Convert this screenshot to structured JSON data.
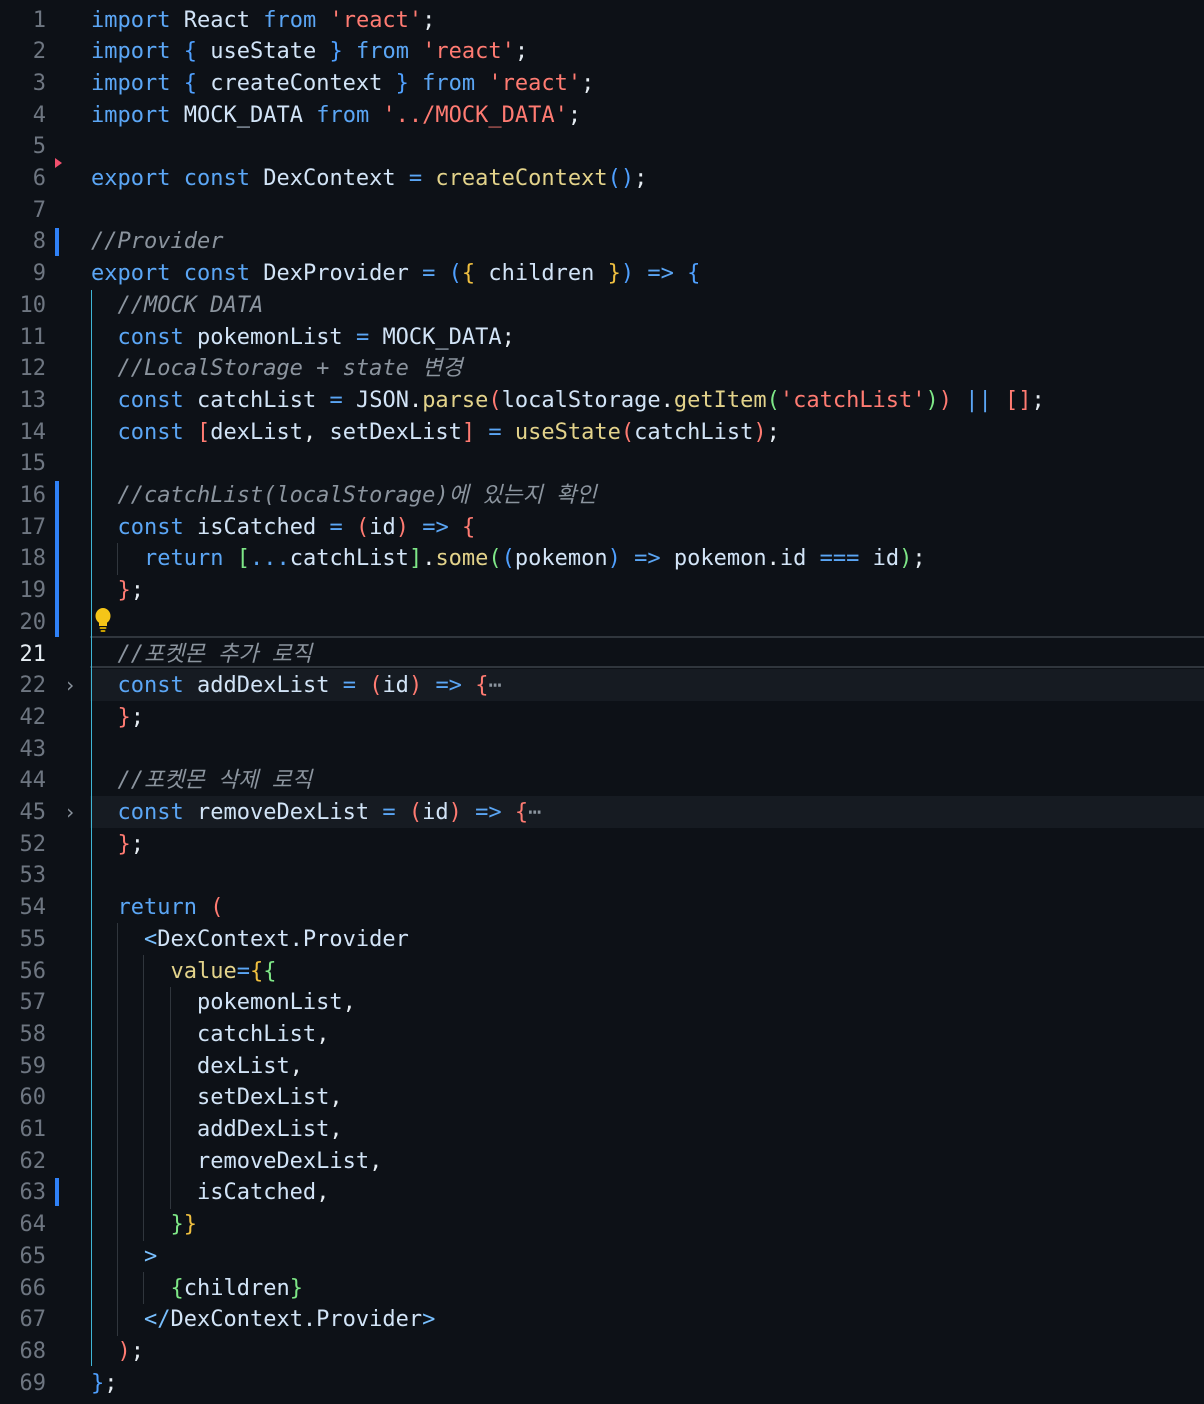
{
  "editor": {
    "active_line": "21",
    "lines": [
      {
        "n": "1",
        "tokens": [
          [
            "k",
            "import"
          ],
          [
            "p",
            " "
          ],
          [
            "v",
            "React"
          ],
          [
            "p",
            " "
          ],
          [
            "k",
            "from"
          ],
          [
            "p",
            " "
          ],
          [
            "s",
            "'react'"
          ],
          [
            "p",
            ";"
          ]
        ]
      },
      {
        "n": "2",
        "tokens": [
          [
            "k",
            "import"
          ],
          [
            "p",
            " "
          ],
          [
            "b3",
            "{"
          ],
          [
            "p",
            " "
          ],
          [
            "v",
            "useState"
          ],
          [
            "p",
            " "
          ],
          [
            "b3",
            "}"
          ],
          [
            "p",
            " "
          ],
          [
            "k",
            "from"
          ],
          [
            "p",
            " "
          ],
          [
            "s",
            "'react'"
          ],
          [
            "p",
            ";"
          ]
        ]
      },
      {
        "n": "3",
        "tokens": [
          [
            "k",
            "import"
          ],
          [
            "p",
            " "
          ],
          [
            "b3",
            "{"
          ],
          [
            "p",
            " "
          ],
          [
            "v",
            "createContext"
          ],
          [
            "p",
            " "
          ],
          [
            "b3",
            "}"
          ],
          [
            "p",
            " "
          ],
          [
            "k",
            "from"
          ],
          [
            "p",
            " "
          ],
          [
            "s",
            "'react'"
          ],
          [
            "p",
            ";"
          ]
        ]
      },
      {
        "n": "4",
        "tokens": [
          [
            "k",
            "import"
          ],
          [
            "p",
            " "
          ],
          [
            "v",
            "MOCK_DATA"
          ],
          [
            "p",
            " "
          ],
          [
            "k",
            "from"
          ],
          [
            "p",
            " "
          ],
          [
            "s",
            "'../MOCK_DATA'"
          ],
          [
            "p",
            ";"
          ]
        ]
      },
      {
        "n": "5",
        "tokens": []
      },
      {
        "n": "6",
        "tokens": [
          [
            "k",
            "export"
          ],
          [
            "p",
            " "
          ],
          [
            "k",
            "const"
          ],
          [
            "p",
            " "
          ],
          [
            "v",
            "DexContext"
          ],
          [
            "p",
            " "
          ],
          [
            "o",
            "="
          ],
          [
            "p",
            " "
          ],
          [
            "f",
            "createContext"
          ],
          [
            "b3",
            "()"
          ],
          [
            "p",
            ";"
          ]
        ]
      },
      {
        "n": "7",
        "tokens": []
      },
      {
        "n": "8",
        "tokens": [
          [
            "c",
            "//Provider"
          ]
        ]
      },
      {
        "n": "9",
        "tokens": [
          [
            "k",
            "export"
          ],
          [
            "p",
            " "
          ],
          [
            "k",
            "const"
          ],
          [
            "p",
            " "
          ],
          [
            "v",
            "DexProvider"
          ],
          [
            "p",
            " "
          ],
          [
            "o",
            "="
          ],
          [
            "p",
            " "
          ],
          [
            "b3",
            "("
          ],
          [
            "b1",
            "{"
          ],
          [
            "p",
            " "
          ],
          [
            "v",
            "children"
          ],
          [
            "p",
            " "
          ],
          [
            "b1",
            "}"
          ],
          [
            "b3",
            ")"
          ],
          [
            "p",
            " "
          ],
          [
            "o",
            "=>"
          ],
          [
            "p",
            " "
          ],
          [
            "b3",
            "{"
          ]
        ]
      },
      {
        "n": "10",
        "tokens": [
          [
            "p",
            "  "
          ],
          [
            "c",
            "//MOCK DATA"
          ]
        ]
      },
      {
        "n": "11",
        "tokens": [
          [
            "p",
            "  "
          ],
          [
            "k",
            "const"
          ],
          [
            "p",
            " "
          ],
          [
            "v",
            "pokemonList"
          ],
          [
            "p",
            " "
          ],
          [
            "o",
            "="
          ],
          [
            "p",
            " "
          ],
          [
            "v",
            "MOCK_DATA"
          ],
          [
            "p",
            ";"
          ]
        ]
      },
      {
        "n": "12",
        "tokens": [
          [
            "p",
            "  "
          ],
          [
            "c",
            "//LocalStorage + state 변경"
          ]
        ]
      },
      {
        "n": "13",
        "tokens": [
          [
            "p",
            "  "
          ],
          [
            "k",
            "const"
          ],
          [
            "p",
            " "
          ],
          [
            "v",
            "catchList"
          ],
          [
            "p",
            " "
          ],
          [
            "o",
            "="
          ],
          [
            "p",
            " "
          ],
          [
            "v",
            "JSON"
          ],
          [
            "p",
            "."
          ],
          [
            "f",
            "parse"
          ],
          [
            "pr",
            "("
          ],
          [
            "v",
            "localStorage"
          ],
          [
            "p",
            "."
          ],
          [
            "f",
            "getItem"
          ],
          [
            "g",
            "("
          ],
          [
            "s",
            "'catchList'"
          ],
          [
            "g",
            ")"
          ],
          [
            "pr",
            ")"
          ],
          [
            "p",
            " "
          ],
          [
            "o",
            "||"
          ],
          [
            "p",
            " "
          ],
          [
            "pr",
            "[]"
          ],
          [
            "p",
            ";"
          ]
        ]
      },
      {
        "n": "14",
        "tokens": [
          [
            "p",
            "  "
          ],
          [
            "k",
            "const"
          ],
          [
            "p",
            " "
          ],
          [
            "pr",
            "["
          ],
          [
            "v",
            "dexList"
          ],
          [
            "p",
            ", "
          ],
          [
            "v",
            "setDexList"
          ],
          [
            "pr",
            "]"
          ],
          [
            "p",
            " "
          ],
          [
            "o",
            "="
          ],
          [
            "p",
            " "
          ],
          [
            "f",
            "useState"
          ],
          [
            "pr",
            "("
          ],
          [
            "v",
            "catchList"
          ],
          [
            "pr",
            ")"
          ],
          [
            "p",
            ";"
          ]
        ]
      },
      {
        "n": "15",
        "tokens": []
      },
      {
        "n": "16",
        "tokens": [
          [
            "p",
            "  "
          ],
          [
            "c",
            "//catchList(localStorage)에 있는지 확인"
          ]
        ]
      },
      {
        "n": "17",
        "tokens": [
          [
            "p",
            "  "
          ],
          [
            "k",
            "const"
          ],
          [
            "p",
            " "
          ],
          [
            "v",
            "isCatched"
          ],
          [
            "p",
            " "
          ],
          [
            "o",
            "="
          ],
          [
            "p",
            " "
          ],
          [
            "pr",
            "("
          ],
          [
            "v",
            "id"
          ],
          [
            "pr",
            ")"
          ],
          [
            "p",
            " "
          ],
          [
            "o",
            "=>"
          ],
          [
            "p",
            " "
          ],
          [
            "pr",
            "{"
          ]
        ]
      },
      {
        "n": "18",
        "tokens": [
          [
            "p",
            "    "
          ],
          [
            "k",
            "return"
          ],
          [
            "p",
            " "
          ],
          [
            "g",
            "["
          ],
          [
            "o",
            "..."
          ],
          [
            "v",
            "catchList"
          ],
          [
            "g",
            "]"
          ],
          [
            "p",
            "."
          ],
          [
            "f",
            "some"
          ],
          [
            "g",
            "("
          ],
          [
            "b3",
            "("
          ],
          [
            "v",
            "pokemon"
          ],
          [
            "b3",
            ")"
          ],
          [
            "p",
            " "
          ],
          [
            "o",
            "=>"
          ],
          [
            "p",
            " "
          ],
          [
            "v",
            "pokemon"
          ],
          [
            "p",
            "."
          ],
          [
            "v",
            "id"
          ],
          [
            "p",
            " "
          ],
          [
            "o",
            "==="
          ],
          [
            "p",
            " "
          ],
          [
            "v",
            "id"
          ],
          [
            "g",
            ")"
          ],
          [
            "p",
            ";"
          ]
        ]
      },
      {
        "n": "19",
        "tokens": [
          [
            "p",
            "  "
          ],
          [
            "pr",
            "}"
          ],
          [
            "p",
            ";"
          ]
        ]
      },
      {
        "n": "20",
        "tokens": []
      },
      {
        "n": "21",
        "tokens": [
          [
            "p",
            "  "
          ],
          [
            "c",
            "//포켓몬 추가 로직"
          ]
        ]
      },
      {
        "n": "22",
        "tokens": [
          [
            "p",
            "  "
          ],
          [
            "k",
            "const"
          ],
          [
            "p",
            " "
          ],
          [
            "v",
            "addDexList"
          ],
          [
            "p",
            " "
          ],
          [
            "o",
            "="
          ],
          [
            "p",
            " "
          ],
          [
            "pr",
            "("
          ],
          [
            "v",
            "id"
          ],
          [
            "pr",
            ")"
          ],
          [
            "p",
            " "
          ],
          [
            "o",
            "=>"
          ],
          [
            "p",
            " "
          ],
          [
            "pr",
            "{"
          ],
          [
            "ellipsis",
            "⋯"
          ]
        ]
      },
      {
        "n": "42",
        "tokens": [
          [
            "p",
            "  "
          ],
          [
            "pr",
            "}"
          ],
          [
            "p",
            ";"
          ]
        ]
      },
      {
        "n": "43",
        "tokens": []
      },
      {
        "n": "44",
        "tokens": [
          [
            "p",
            "  "
          ],
          [
            "c",
            "//포켓몬 삭제 로직"
          ]
        ]
      },
      {
        "n": "45",
        "tokens": [
          [
            "p",
            "  "
          ],
          [
            "k",
            "const"
          ],
          [
            "p",
            " "
          ],
          [
            "v",
            "removeDexList"
          ],
          [
            "p",
            " "
          ],
          [
            "o",
            "="
          ],
          [
            "p",
            " "
          ],
          [
            "pr",
            "("
          ],
          [
            "v",
            "id"
          ],
          [
            "pr",
            ")"
          ],
          [
            "p",
            " "
          ],
          [
            "o",
            "=>"
          ],
          [
            "p",
            " "
          ],
          [
            "pr",
            "{"
          ],
          [
            "ellipsis",
            "⋯"
          ]
        ]
      },
      {
        "n": "52",
        "tokens": [
          [
            "p",
            "  "
          ],
          [
            "pr",
            "}"
          ],
          [
            "p",
            ";"
          ]
        ]
      },
      {
        "n": "53",
        "tokens": []
      },
      {
        "n": "54",
        "tokens": [
          [
            "p",
            "  "
          ],
          [
            "k",
            "return"
          ],
          [
            "p",
            " "
          ],
          [
            "pr",
            "("
          ]
        ]
      },
      {
        "n": "55",
        "tokens": [
          [
            "p",
            "    "
          ],
          [
            "t",
            "<"
          ],
          [
            "v",
            "DexContext.Provider"
          ]
        ]
      },
      {
        "n": "56",
        "tokens": [
          [
            "p",
            "      "
          ],
          [
            "f",
            "value"
          ],
          [
            "o",
            "="
          ],
          [
            "b1",
            "{"
          ],
          [
            "g",
            "{"
          ]
        ]
      },
      {
        "n": "57",
        "tokens": [
          [
            "p",
            "        "
          ],
          [
            "v",
            "pokemonList"
          ],
          [
            "p",
            ","
          ]
        ]
      },
      {
        "n": "58",
        "tokens": [
          [
            "p",
            "        "
          ],
          [
            "v",
            "catchList"
          ],
          [
            "p",
            ","
          ]
        ]
      },
      {
        "n": "59",
        "tokens": [
          [
            "p",
            "        "
          ],
          [
            "v",
            "dexList"
          ],
          [
            "p",
            ","
          ]
        ]
      },
      {
        "n": "60",
        "tokens": [
          [
            "p",
            "        "
          ],
          [
            "v",
            "setDexList"
          ],
          [
            "p",
            ","
          ]
        ]
      },
      {
        "n": "61",
        "tokens": [
          [
            "p",
            "        "
          ],
          [
            "v",
            "addDexList"
          ],
          [
            "p",
            ","
          ]
        ]
      },
      {
        "n": "62",
        "tokens": [
          [
            "p",
            "        "
          ],
          [
            "v",
            "removeDexList"
          ],
          [
            "p",
            ","
          ]
        ]
      },
      {
        "n": "63",
        "tokens": [
          [
            "p",
            "        "
          ],
          [
            "v",
            "isCatched"
          ],
          [
            "p",
            ","
          ]
        ]
      },
      {
        "n": "64",
        "tokens": [
          [
            "p",
            "      "
          ],
          [
            "g",
            "}"
          ],
          [
            "b1",
            "}"
          ]
        ]
      },
      {
        "n": "65",
        "tokens": [
          [
            "p",
            "    "
          ],
          [
            "t",
            ">"
          ]
        ]
      },
      {
        "n": "66",
        "tokens": [
          [
            "p",
            "      "
          ],
          [
            "g",
            "{"
          ],
          [
            "v",
            "children"
          ],
          [
            "g",
            "}"
          ]
        ]
      },
      {
        "n": "67",
        "tokens": [
          [
            "p",
            "    "
          ],
          [
            "t",
            "</"
          ],
          [
            "v",
            "DexContext.Provider"
          ],
          [
            "t",
            ">"
          ]
        ]
      },
      {
        "n": "68",
        "tokens": [
          [
            "p",
            "  "
          ],
          [
            "pr",
            ")"
          ],
          [
            "p",
            ";"
          ]
        ]
      },
      {
        "n": "69",
        "tokens": [
          [
            "b3",
            "}"
          ],
          [
            "p",
            ";"
          ]
        ]
      }
    ]
  },
  "colors": {
    "background": "#0d1117",
    "keyword": "#5ba6f5",
    "string": "#ff7b72",
    "function": "#e3d38b",
    "comment": "#8b949e",
    "modified_gutter": "#2f81f7"
  },
  "icons": {
    "fold_collapsed": "chevron-right-icon",
    "quick_fix": "lightbulb-icon",
    "breakpoint_marker": "triangle-marker-icon"
  }
}
